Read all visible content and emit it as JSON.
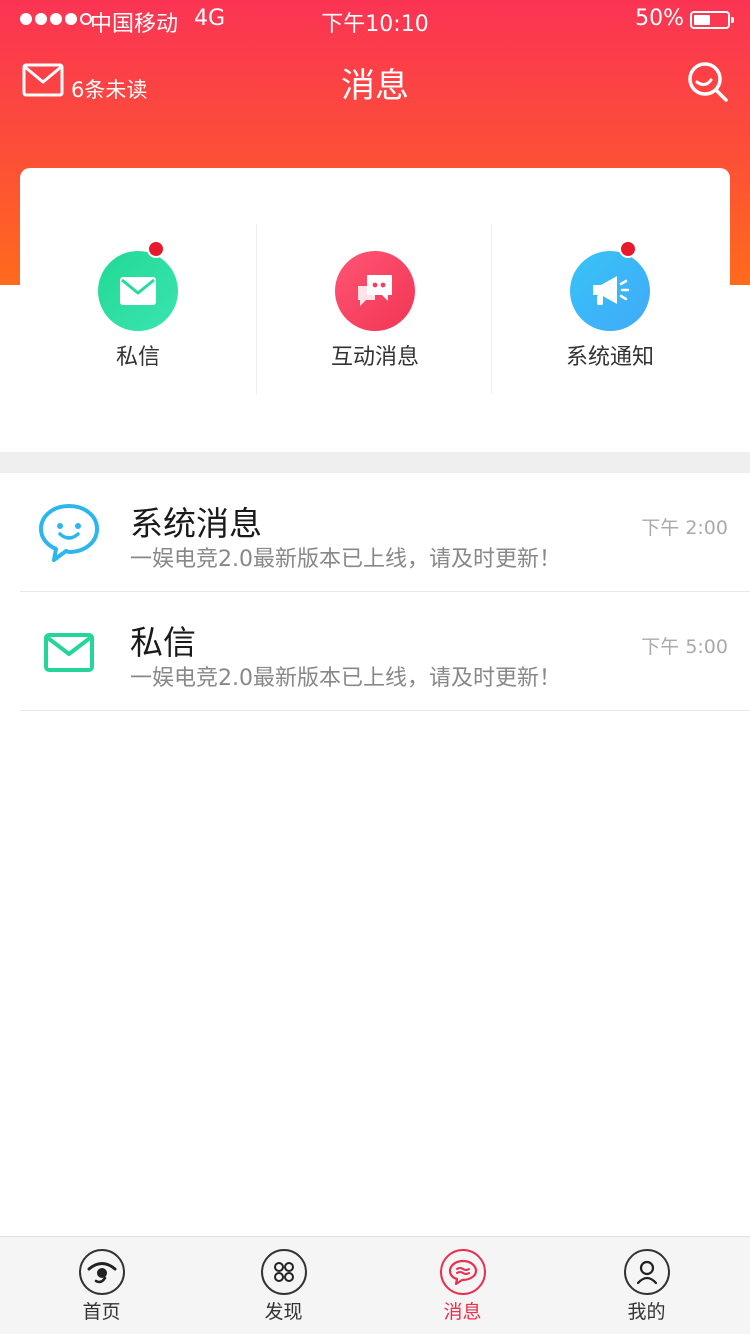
{
  "status_bar": {
    "carrier": "中国移动",
    "network": "4G",
    "time": "下午10:10",
    "battery": "50%",
    "battery_level": 0.5
  },
  "header": {
    "unread_label": "6条未读",
    "title": "消息"
  },
  "categories": [
    {
      "label": "私信",
      "icon": "mail-icon",
      "has_badge": true,
      "color": "#2adf9f"
    },
    {
      "label": "互动消息",
      "icon": "chat-bubbles-icon",
      "has_badge": false,
      "color": "#f4405f"
    },
    {
      "label": "系统通知",
      "icon": "megaphone-icon",
      "has_badge": true,
      "color": "#3bb8f7"
    }
  ],
  "messages": [
    {
      "title": "系统消息",
      "text": "一娱电竞2.0最新版本已上线，请及时更新！",
      "time": "下午 2:00",
      "icon": "smiley-bubble-icon",
      "color": "#2cb6ee"
    },
    {
      "title": "私信",
      "text": "一娱电竞2.0最新版本已上线，请及时更新！",
      "time": "下午 5:00",
      "icon": "mail-icon",
      "color": "#25d59a"
    }
  ],
  "tabs": [
    {
      "label": "首页",
      "icon": "eye-icon",
      "active": false
    },
    {
      "label": "发现",
      "icon": "grid-icon",
      "active": false
    },
    {
      "label": "消息",
      "icon": "chat-icon",
      "active": true
    },
    {
      "label": "我的",
      "icon": "user-icon",
      "active": false
    }
  ],
  "colors": {
    "header_top": "#fb3454",
    "header_bottom": "#ff6a1c",
    "accent": "#e8304f",
    "badge": "#e8192c"
  }
}
